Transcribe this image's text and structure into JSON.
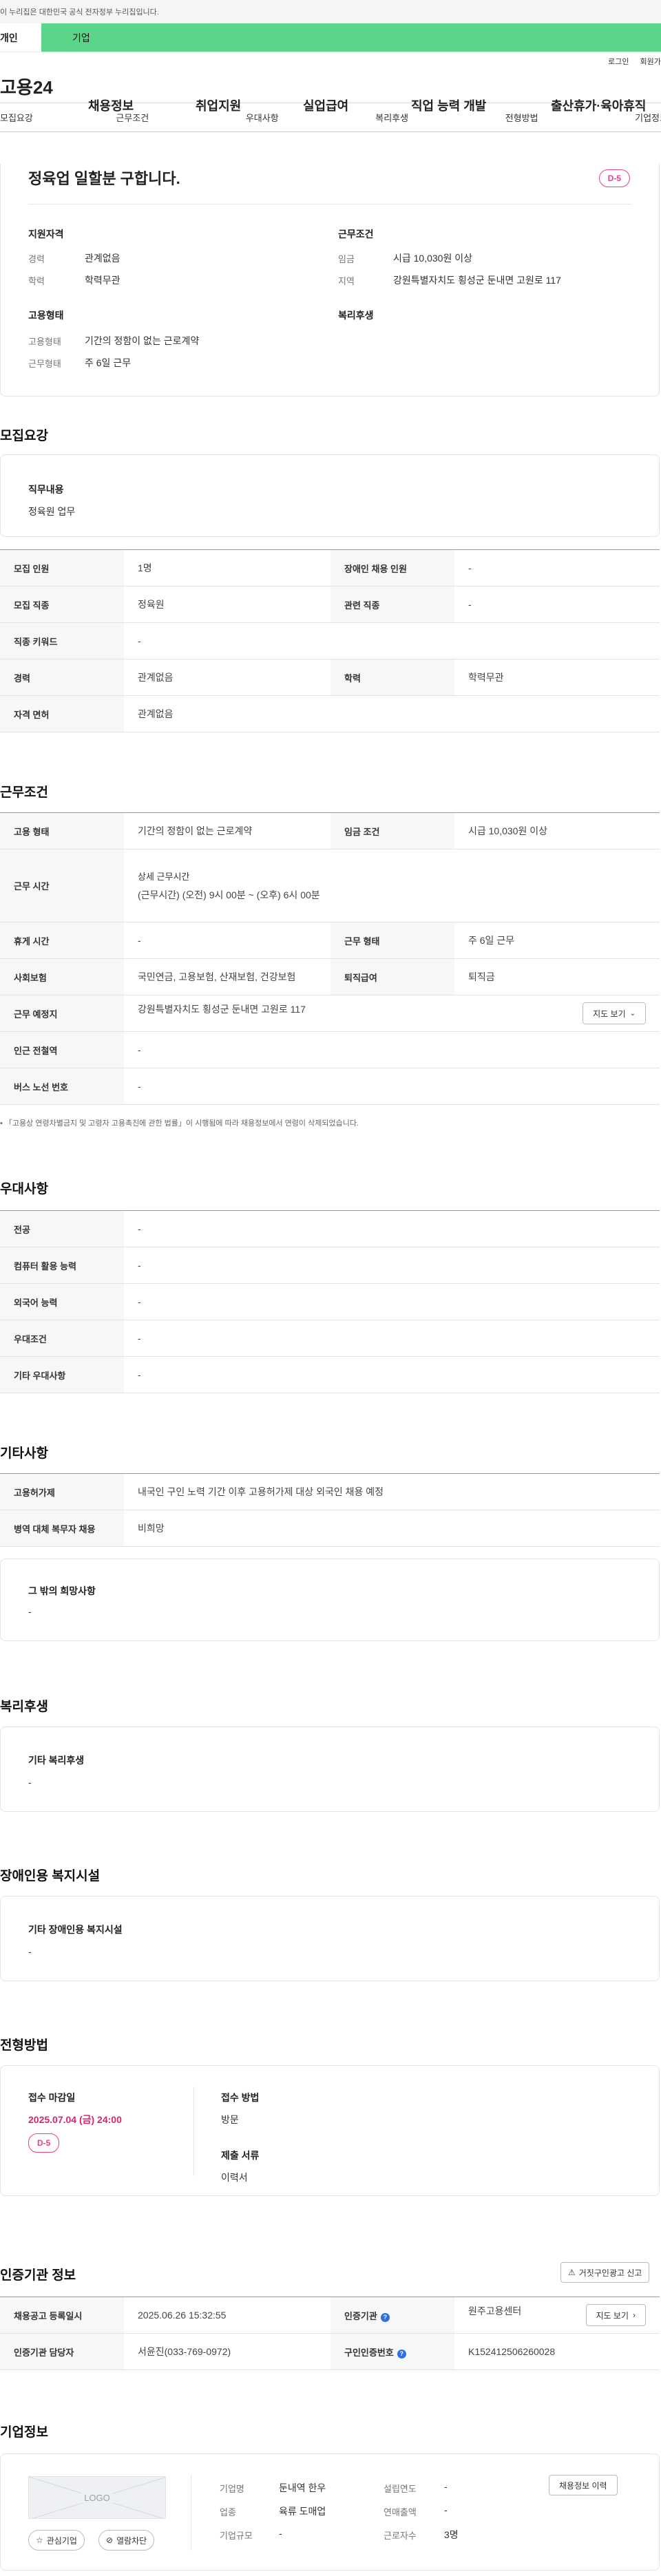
{
  "gov_banner": "이 누리집은 대한민국 공식 전자정부 누리집입니다.",
  "top_tabs": {
    "personal": "개인",
    "company": "기업"
  },
  "util_links": {
    "login": "로그인",
    "join": "회원가입"
  },
  "gnb": {
    "logo": "고용24",
    "items": [
      "채용정보",
      "취업지원",
      "실업급여",
      "직업 능력 개발",
      "출산휴가·육아휴직"
    ]
  },
  "sub_tabs": [
    "모집요강",
    "근무조건",
    "우대사항",
    "복리후생",
    "전형방법",
    "기업정보"
  ],
  "summary": {
    "title": "정육업 일할분 구합니다.",
    "dday": "D-5",
    "qual_title": "지원자격",
    "career_label": "경력",
    "career_value": "관계없음",
    "edu_label": "학력",
    "edu_value": "학력무관",
    "cond_title": "근무조건",
    "wage_label": "임금",
    "wage_value": "시급 10,030원 이상",
    "region_label": "지역",
    "region_value": "강원특별자치도 횡성군 둔내면 고원로 117",
    "emp_title": "고용형태",
    "emptype_label": "고용형태",
    "emptype_value": "기간의 정함이 없는 근로계약",
    "workform_label": "근무형태",
    "workform_value": "주 6일 근무",
    "welfare_title": "복리후생"
  },
  "recruit": {
    "heading": "모집요강",
    "job_title": "직무내용",
    "job_value": "정육원 업무",
    "rows": [
      {
        "l1": "모집 인원",
        "v1": "1명",
        "l2": "장애인 채용 인원",
        "v2": "-"
      },
      {
        "l1": "모집 직종",
        "v1": "정육원",
        "l2": "관련 직종",
        "v2": "-"
      },
      {
        "l1": "직종 키워드",
        "v1": "-"
      },
      {
        "l1": "경력",
        "v1": "관계없음",
        "l2": "학력",
        "v2": "학력무관"
      },
      {
        "l1": "자격 면허",
        "v1": "관계없음"
      }
    ]
  },
  "conditions": {
    "heading": "근무조건",
    "emptype_label": "고용 형태",
    "emptype_value": "기간의 정함이 없는 근로계약",
    "wage_label": "임금 조건",
    "wage_value": "시급 10,030원 이상",
    "hours_label": "근무 시간",
    "hours_title": "상세 근무시간",
    "hours_value": "(근무시간) (오전) 9시 00분 ~ (오후) 6시 00분",
    "rest_label": "휴게 시간",
    "rest_value": "-",
    "form_label": "근무 형태",
    "form_value": "주 6일 근무",
    "ins_label": "사회보험",
    "ins_value": "국민연금, 고용보험, 산재보험, 건강보험",
    "retire_label": "퇴직급여",
    "retire_value": "퇴직금",
    "place_label": "근무 예정지",
    "place_value": "강원특별자치도 횡성군 둔내면 고원로 117",
    "map_btn": "지도 보기",
    "station_label": "인근 전철역",
    "station_value": "-",
    "bus_label": "버스 노선 번호",
    "bus_value": "-",
    "note": "「고용상 연령차별금지 및 고령자 고용촉진에 관한 법률」이 시행됨에 따라 채용정보에서 연령이 삭제되었습니다."
  },
  "prefer": {
    "heading": "우대사항",
    "rows": [
      {
        "label": "전공",
        "value": "-"
      },
      {
        "label": "컴퓨터 활용 능력",
        "value": "-"
      },
      {
        "label": "외국어 능력",
        "value": "-"
      },
      {
        "label": "우대조건",
        "value": "-"
      },
      {
        "label": "기타 우대사항",
        "value": "-"
      }
    ]
  },
  "etc": {
    "heading": "기타사항",
    "rows": [
      {
        "label": "고용허가제",
        "value": "내국인 구인 노력 기간 이후 고용허가제 대상 외국인 채용 예정"
      },
      {
        "label": "병역 대체 복무자 채용",
        "value": "비희망"
      }
    ],
    "box_title": "그 밖의 희망사항",
    "box_value": "-"
  },
  "welfare": {
    "heading": "복리후생",
    "box_title": "기타 복리후생",
    "box_value": "-"
  },
  "disability": {
    "heading": "장애인용 복지시설",
    "box_title": "기타 장애인용 복지시설",
    "box_value": "-"
  },
  "process": {
    "heading": "전형방법",
    "deadline_label": "접수 마감일",
    "deadline_value": "2025.07.04 (금) 24:00",
    "dday": "D-5",
    "method_label": "접수 방법",
    "method_value": "방문",
    "docs_label": "제출 서류",
    "docs_value": "이력서"
  },
  "agency": {
    "heading": "인증기관 정보",
    "report_btn": "거짓구인광고 신고",
    "reg_label": "채용공고 등록일시",
    "reg_value": "2025.06.26 15:32:55",
    "org_label": "인증기관",
    "org_value": "원주고용센터",
    "map_btn": "지도 보기",
    "staff_label": "인증기관 담당자",
    "staff_value": "서윤진(033-769-0972)",
    "num_label": "구인인증번호",
    "num_value": "K152412506260028"
  },
  "company": {
    "heading": "기업정보",
    "logo_text": "LOGO",
    "fav_btn": "관심기업",
    "block_btn": "열람차단",
    "name_label": "기업명",
    "name_value": "둔내역 한우",
    "industry_label": "업종",
    "industry_value": "육류 도매업",
    "size_label": "기업규모",
    "size_value": "-",
    "founded_label": "설립연도",
    "founded_value": "-",
    "sales_label": "연매출액",
    "sales_value": "-",
    "staff_label": "근로자수",
    "staff_value": "3명",
    "history_btn": "채용정보 이력"
  },
  "colors": {
    "accent_green": "#5bd58a",
    "dday_pink": "#e8418b",
    "deadline_red": "#d6246e",
    "info_blue": "#2f6fe0"
  }
}
